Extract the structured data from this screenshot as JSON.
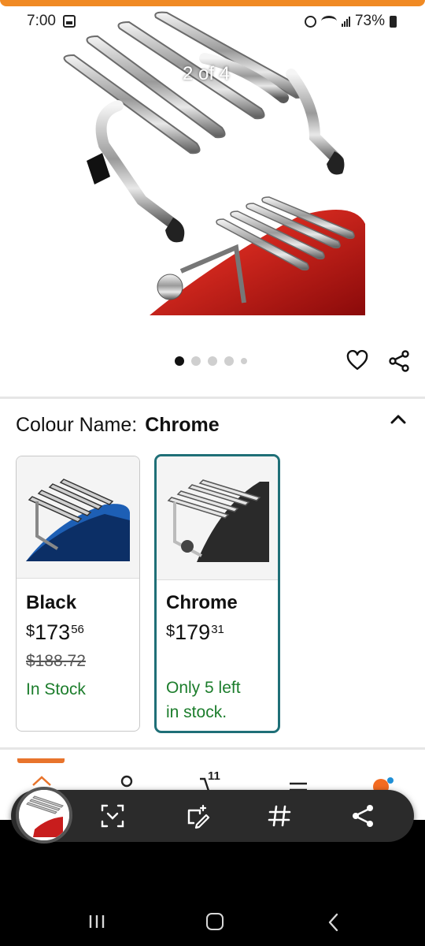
{
  "status_bar": {
    "time": "7:00",
    "battery": "73%"
  },
  "gallery": {
    "counter": "2 of 4",
    "dots_total": 5,
    "active_dot": 1
  },
  "colour": {
    "label": "Colour Name:",
    "value": "Chrome"
  },
  "variants": [
    {
      "name": "Black",
      "currency": "$",
      "price_whole": "173",
      "price_cents": "56",
      "was_price": "$188.72",
      "stock_lines": [
        "In Stock"
      ],
      "selected": false
    },
    {
      "name": "Chrome",
      "currency": "$",
      "price_whole": "179",
      "price_cents": "31",
      "was_price": "",
      "stock_lines": [
        "Only 5 left",
        "in stock."
      ],
      "selected": true
    }
  ],
  "bottom_nav": {
    "cart_count": "11",
    "accent_color": "#e8742c"
  },
  "colors": {
    "stock_green": "#1c7d2c",
    "selected_border": "#1f6f77",
    "top_bar": "#f08a24"
  }
}
